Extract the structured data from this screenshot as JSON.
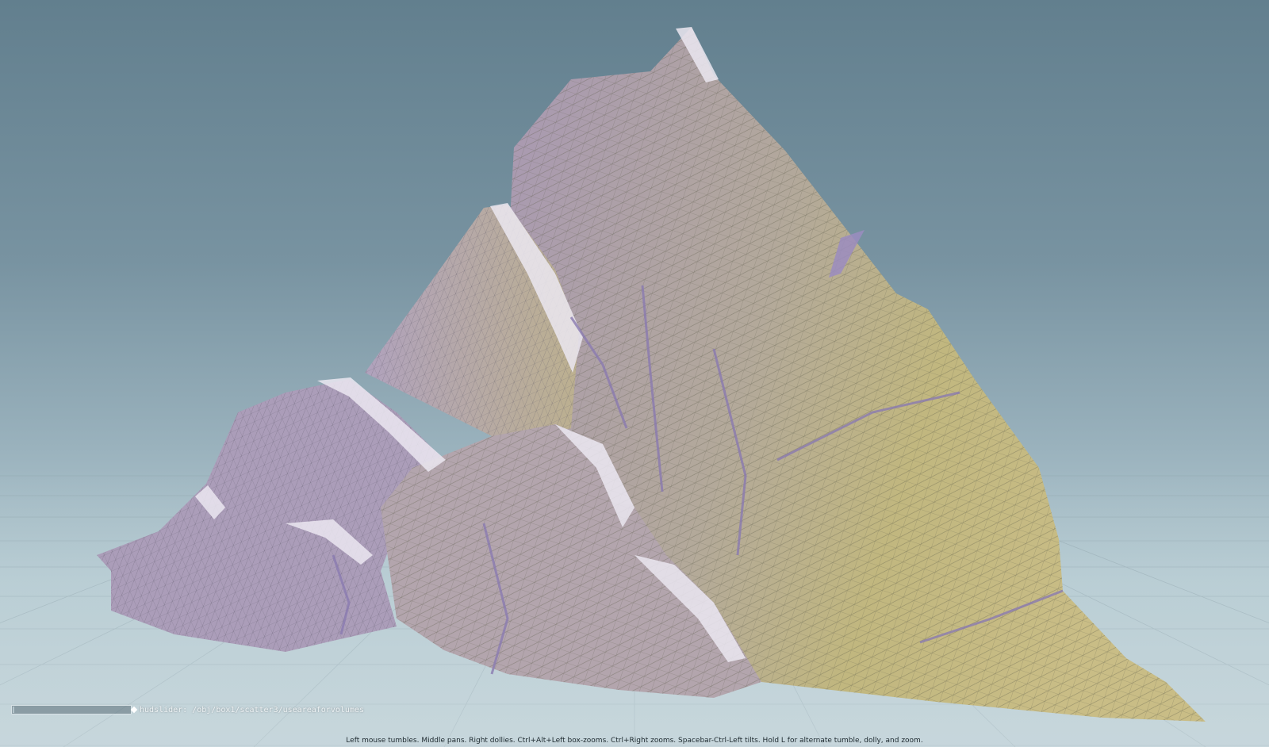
{
  "viewport": {
    "hud_slider": {
      "label": "hudslider: /obj/box1/scatter3/useareaforvolumes",
      "value": 0.0
    },
    "status_hint": "Left mouse tumbles. Middle pans. Right dollies. Ctrl+Alt+Left box-zooms. Ctrl+Right zooms. Spacebar-Ctrl-Left tilts. Hold L for alternate tumble, dolly, and zoom."
  },
  "colors": {
    "background_top": "#627f8e",
    "background_bottom": "#c6d6dc",
    "rock_lit": "#bfb57e",
    "rock_shadow": "#a597b3",
    "rock_highlight": "#e8e4ee",
    "wireframe": "#6b6a55",
    "grid": "#8fa3ab"
  },
  "icons": {
    "hud_handle": "diamond-icon"
  }
}
